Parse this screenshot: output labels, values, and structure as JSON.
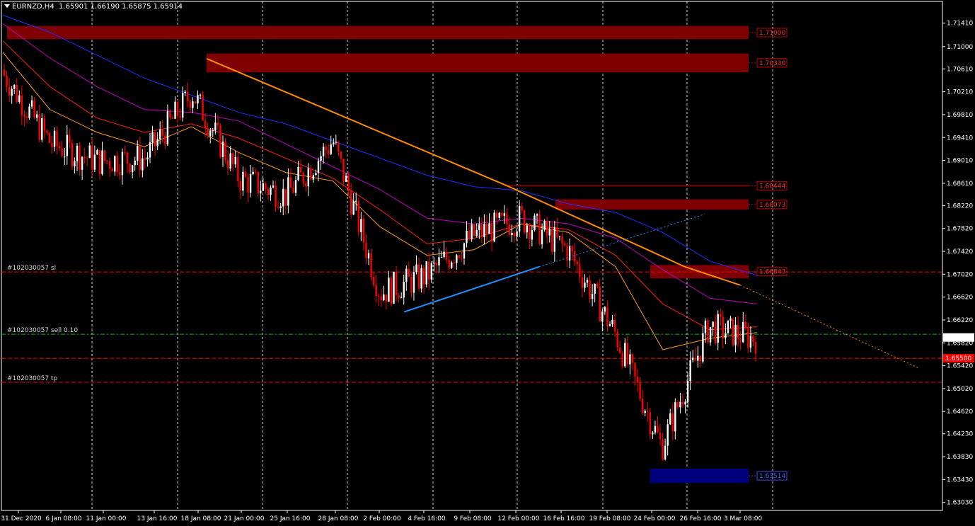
{
  "header": {
    "symbol_timeframe": "EURNZD,H4",
    "ohlc": "1.65901 1.66190 1.65875 1.65914"
  },
  "colors": {
    "background": "#000000",
    "grid": "#ffffff",
    "bull_candle": "#ffffff",
    "bear_candle": "#ff0000",
    "zone_red": "#7f0000",
    "zone_blue": "#00007f",
    "trend_orange": "#ff8c00",
    "trend_blue": "#1e90ff",
    "ema_blue": "#1f2fff",
    "ema_purple": "#c000c0",
    "ema_red": "#ff2020",
    "ema_orange": "#ff9a20",
    "price_tag": "#ffffff",
    "level_tag": "#ff0000"
  },
  "chart_data": {
    "type": "candlestick",
    "ylim": [
      1.6289,
      1.7179
    ],
    "yticks": [
      "1.71410",
      "1.71000",
      "1.70610",
      "1.70210",
      "1.69810",
      "1.69410",
      "1.69010",
      "1.68610",
      "1.68220",
      "1.67820",
      "1.67420",
      "1.67020",
      "1.66620",
      "1.66220",
      "1.65820",
      "1.65420",
      "1.65020",
      "1.64620",
      "1.64230",
      "1.63830",
      "1.63430",
      "1.63030"
    ],
    "xticks": [
      "31 Dec 2020",
      "6 Jan 08:00",
      "11 Jan 00:00",
      "13 Jan 16:00",
      "18 Jan 08:00",
      "21 Jan 00:00",
      "25 Jan 16:00",
      "28 Jan 08:00",
      "2 Feb 00:00",
      "4 Feb 16:00",
      "9 Feb 08:00",
      "12 Feb 00:00",
      "16 Feb 16:00",
      "19 Feb 08:00",
      "24 Feb 00:00",
      "26 Feb 16:00",
      "3 Mar 08:00"
    ],
    "current_price": "1.65914",
    "zones": [
      {
        "label": "1.71000",
        "color": "red",
        "top": 1.7136,
        "bottom": 1.7113,
        "from": "31 Dec 2020",
        "to": "3 Mar 08:00"
      },
      {
        "label": "1.70330",
        "color": "red",
        "top": 1.7088,
        "bottom": 1.7055,
        "from": "18 Jan 08:00",
        "to": "3 Mar 08:00"
      },
      {
        "label": "1.68444",
        "color": "red",
        "top": 1.6858,
        "bottom": 1.6857,
        "from": "12 Feb 00:00",
        "to": "3 Mar 08:00"
      },
      {
        "label": "1.68073",
        "color": "red",
        "top": 1.6833,
        "bottom": 1.6815,
        "from": "16 Feb 16:00",
        "to": "3 Mar 08:00"
      },
      {
        "label": "1.66843",
        "color": "red",
        "top": 1.6718,
        "bottom": 1.6695,
        "from": "24 Feb 00:00",
        "to": "3 Mar 08:00"
      },
      {
        "label": "1.63514",
        "color": "blue",
        "top": 1.6362,
        "bottom": 1.6337,
        "from": "24 Feb 00:00",
        "to": "3 Mar 08:00"
      }
    ],
    "order_lines": [
      {
        "label": "#102030057 sl",
        "price": 1.6706,
        "style": "red"
      },
      {
        "label": "#102030057 sell 0.10",
        "price": 1.6597,
        "style": "green"
      },
      {
        "label": "",
        "price": 1.6555,
        "style": "red",
        "price_tag": "1.65500"
      },
      {
        "label": "#102030057 tp",
        "price": 1.6513,
        "style": "red"
      }
    ],
    "trendlines": [
      {
        "color": "orange",
        "points": [
          [
            "18 Jan 08:00",
            1.7079
          ],
          [
            "12 Feb 00:00",
            1.6857
          ],
          [
            "24 Feb 00:00",
            1.6715
          ],
          [
            "3 Mar 08:00",
            1.6683
          ]
        ],
        "extension_to": 1.6537
      },
      {
        "color": "blue",
        "points": [
          [
            "2 Feb 00:00",
            1.6636
          ],
          [
            "16 Feb 16:00",
            1.6715
          ]
        ],
        "extension_to": 1.6807
      }
    ],
    "ema_series": [
      {
        "color": "blue",
        "values": [
          1.7155,
          1.7125,
          1.7085,
          1.7045,
          1.7015,
          1.6985,
          1.6965,
          1.6935,
          1.6905,
          1.6875,
          1.6855,
          1.6848,
          1.6825,
          1.681,
          1.6775,
          1.6725,
          1.67
        ]
      },
      {
        "color": "purple",
        "values": [
          1.714,
          1.708,
          1.703,
          1.699,
          1.6985,
          1.697,
          1.693,
          1.689,
          1.685,
          1.68,
          1.679,
          1.68,
          1.679,
          1.6765,
          1.671,
          1.666,
          1.665
        ]
      },
      {
        "color": "red",
        "values": [
          1.711,
          1.703,
          1.6975,
          1.695,
          1.6965,
          1.694,
          1.6905,
          1.687,
          1.6815,
          1.6755,
          1.6765,
          1.679,
          1.678,
          1.6735,
          1.665,
          1.6605,
          1.661
        ]
      },
      {
        "color": "orange",
        "values": [
          1.709,
          1.699,
          1.695,
          1.6925,
          1.696,
          1.6915,
          1.688,
          1.6865,
          1.6785,
          1.6735,
          1.6745,
          1.679,
          1.6775,
          1.6715,
          1.657,
          1.659,
          1.66
        ]
      }
    ],
    "candles_close": [
      1.705,
      1.693,
      1.69,
      1.6905,
      1.702,
      1.687,
      1.684,
      1.6935,
      1.667,
      1.67,
      1.677,
      1.68,
      1.6745,
      1.66,
      1.64,
      1.661,
      1.659
    ]
  }
}
